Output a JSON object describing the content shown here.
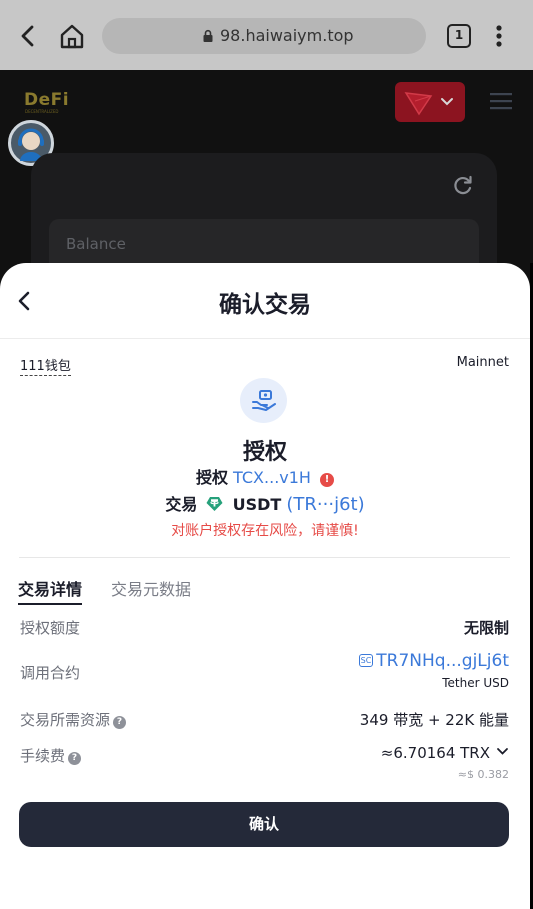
{
  "browser": {
    "url": "98.haiwaiym.top",
    "tab_count": "1",
    "icons": [
      "back-arrow-icon",
      "home-icon",
      "lock-icon",
      "tab-switcher-icon",
      "more-vert-icon"
    ]
  },
  "dapp": {
    "logo": "DeFi",
    "logo_sub": "DECENTRALIZED",
    "balance_label": "Balance",
    "icons": [
      "tron-logo-icon",
      "chevron-down-icon",
      "hamburger-menu-icon",
      "support-avatar-icon",
      "refresh-icon"
    ]
  },
  "sheet": {
    "title": "确认交易",
    "wallet_name": "111钱包",
    "network": "Mainnet",
    "action_icon": "hand-money-icon",
    "action_title": "授权",
    "authorize_label": "授权",
    "authorize_address": "TCX...v1H",
    "transaction_label": "交易",
    "token_symbol": "USDT",
    "token_address": "(TR···j6t)",
    "risk_warning": "对账户授权存在风险，请谨慎!",
    "tabs": {
      "details": "交易详情",
      "metadata": "交易元数据"
    },
    "rows": {
      "allowance_label": "授权额度",
      "allowance_value": "无限制",
      "contract_label": "调用合约",
      "contract_badge": "SC",
      "contract_address": "TR7NHq...gjLj6t",
      "contract_name": "Tether USD",
      "resources_label": "交易所需资源",
      "resources_value": "349 带宽 + 22K 能量",
      "fee_label": "手续费",
      "fee_value": "≈6.70164 TRX",
      "fee_usd": "≈$ 0.382"
    },
    "confirm_label": "确认"
  },
  "colors": {
    "accent_blue": "#3b79d9",
    "danger_red": "#e64b47",
    "button_dark": "#242939",
    "tron_red": "#8c1420"
  }
}
